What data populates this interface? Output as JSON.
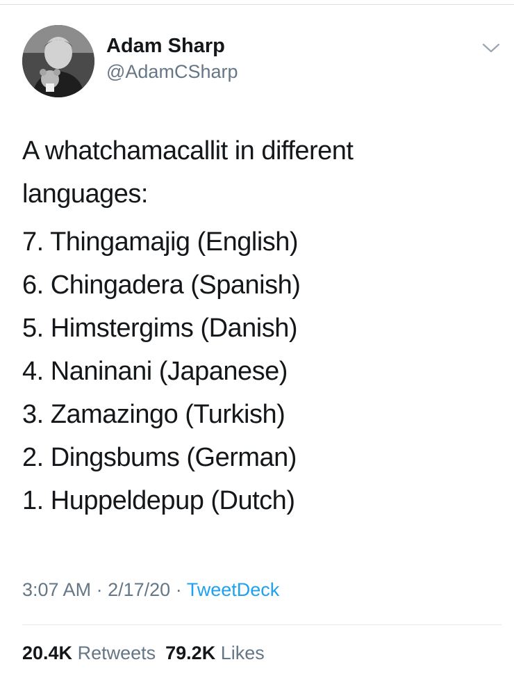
{
  "author": {
    "display_name": "Adam Sharp",
    "handle": "@AdamCSharp",
    "avatar_icon": "user-photo-avatar"
  },
  "menu_icon": "chevron-down-icon",
  "tweet": {
    "intro_line_1": "A whatchamacallit in different",
    "intro_line_2": "languages:",
    "list": [
      "7. Thingamajig (English)",
      "6. Chingadera (Spanish)",
      "5. Himstergims (Danish)",
      "4. Naninani (Japanese)",
      "3. Zamazingo (Turkish)",
      "2. Dingsbums (German)",
      "1. Huppeldepup (Dutch)"
    ]
  },
  "meta": {
    "time": "3:07 AM",
    "separator": "·",
    "date": "2/17/20",
    "source": "TweetDeck"
  },
  "stats": {
    "retweets_count": "20.4K",
    "retweets_label": "Retweets",
    "likes_count": "79.2K",
    "likes_label": "Likes"
  },
  "colors": {
    "link": "#1da1f2",
    "secondary_text": "#657786",
    "primary_text": "#14171a"
  }
}
